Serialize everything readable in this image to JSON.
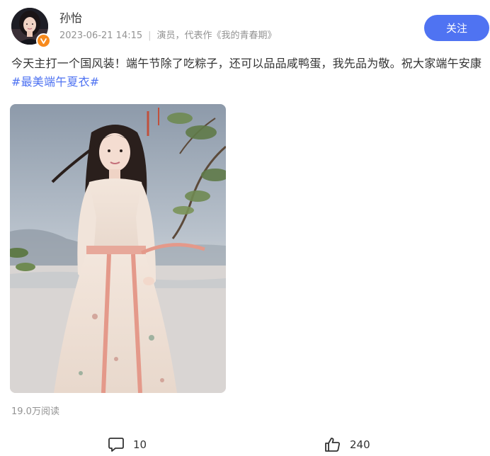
{
  "user": {
    "name": "孙怡",
    "timestamp": "2023-06-21 14:15",
    "description": "演员，代表作《我的青春期》",
    "verified_badge_color": "#f78a1d"
  },
  "follow_button": {
    "label": "关注",
    "color": "#4f73f2"
  },
  "post": {
    "text": "今天主打一个国风装！端午节除了吃粽子，还可以品品咸鸭蛋，我先品为敬。祝大家端午安康",
    "hashtag": "#最美端午夏衣#",
    "hashtag_color": "#4f73f2",
    "image_icon": "photo-of-woman-in-hanfu",
    "read_count": "19.0万阅读"
  },
  "actions": {
    "comment": {
      "icon": "comment-icon",
      "count": "10"
    },
    "like": {
      "icon": "thumbs-up-icon",
      "count": "240"
    }
  }
}
